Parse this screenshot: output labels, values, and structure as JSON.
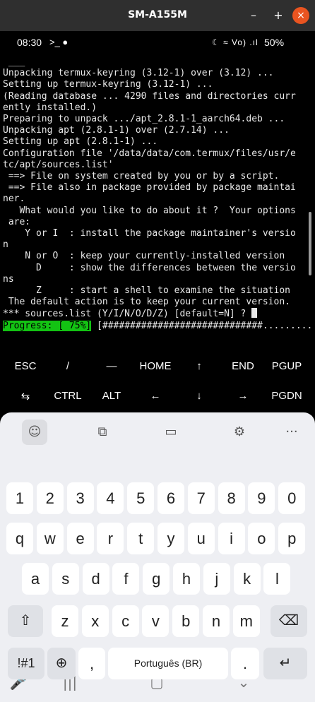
{
  "window": {
    "title": "SM-A155M",
    "minimize": "–",
    "maximize": "+",
    "close": "×"
  },
  "status": {
    "time": "08:30",
    "notif_icons": ">_ ●",
    "icons": "☾ ≈ Vo) .ıl",
    "battery": "50%"
  },
  "terminal": {
    "lines": [
      " ___",
      "Unpacking termux-keyring (3.12-1) over (3.12) ...",
      "Setting up termux-keyring (3.12-1) ...",
      "(Reading database ... 4290 files and directories curr",
      "ently installed.)",
      "Preparing to unpack .../apt_2.8.1-1_aarch64.deb ...",
      "Unpacking apt (2.8.1-1) over (2.7.14) ...",
      "Setting up apt (2.8.1-1) ...",
      "",
      "Configuration file '/data/data/com.termux/files/usr/e",
      "tc/apt/sources.list'",
      " ==> File on system created by you or by a script.",
      " ==> File also in package provided by package maintai",
      "ner.",
      "   What would you like to do about it ?  Your options",
      " are:",
      "    Y or I  : install the package maintainer's versio",
      "n",
      "    N or O  : keep your currently-installed version",
      "      D     : show the differences between the versio",
      "ns",
      "      Z     : start a shell to examine the situation",
      " The default action is to keep your current version.",
      "*** sources.list (Y/I/N/O/D/Z) [default=N] ? "
    ],
    "progress_label": "Progress: [ 75%]",
    "progress_bar": " [#############################.........]"
  },
  "extra_keys": {
    "row1": [
      "ESC",
      "/",
      "—",
      "HOME",
      "↑",
      "END",
      "PGUP"
    ],
    "row2": [
      "⇆",
      "CTRL",
      "ALT",
      "←",
      "↓",
      "→",
      "PGDN"
    ]
  },
  "keyboard": {
    "toolbar": [
      "☺",
      "⧉",
      "▭",
      "⚙",
      "···"
    ],
    "numbers": [
      "1",
      "2",
      "3",
      "4",
      "5",
      "6",
      "7",
      "8",
      "9",
      "0"
    ],
    "row_q": [
      "q",
      "w",
      "e",
      "r",
      "t",
      "y",
      "u",
      "i",
      "o",
      "p"
    ],
    "row_a": [
      "a",
      "s",
      "d",
      "f",
      "g",
      "h",
      "j",
      "k",
      "l"
    ],
    "row_z": [
      "z",
      "x",
      "c",
      "v",
      "b",
      "n",
      "m"
    ],
    "shift": "⇧",
    "backspace": "⌫",
    "symbols": "!#1",
    "globe": "⊕",
    "comma": ",",
    "space_label": "Português (BR)",
    "period": ".",
    "enter": "↵"
  },
  "navbar": {
    "mic": "🎤",
    "recents": "|||",
    "home": "▢",
    "back": "⌄"
  }
}
